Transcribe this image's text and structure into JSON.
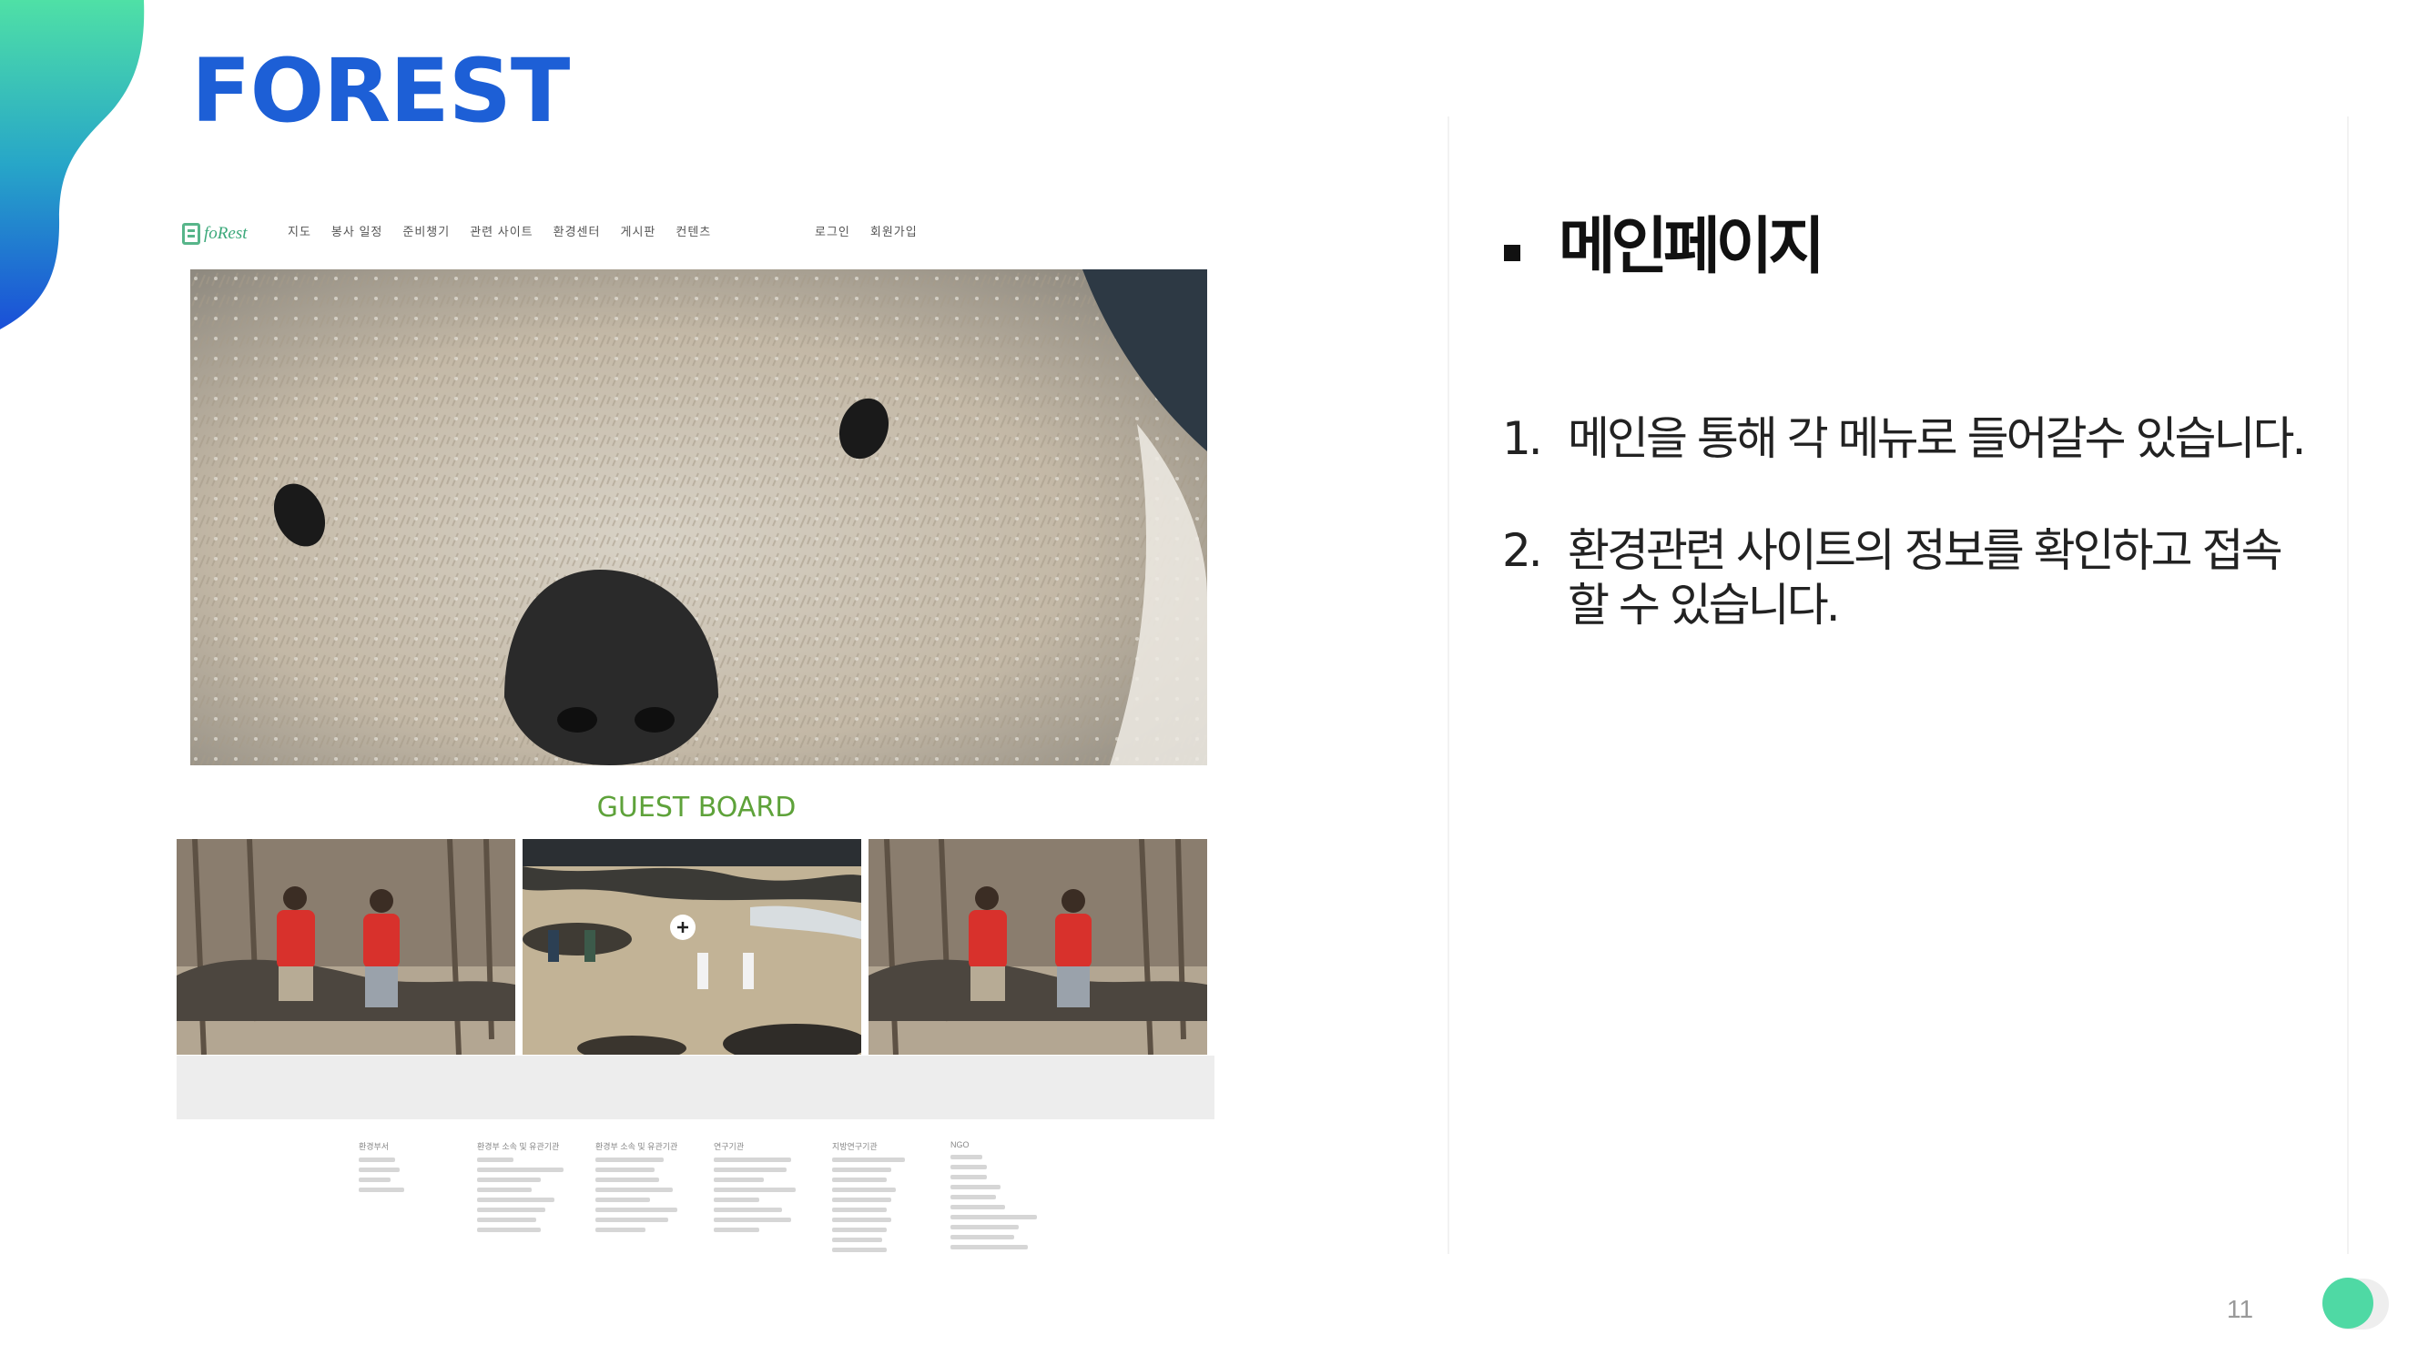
{
  "slide": {
    "title": "FOREST",
    "section_heading": "메인페이지",
    "items": [
      {
        "num": "1.",
        "text": "메인을 통해 각 메뉴로 들어갈수 있습니다."
      },
      {
        "num": "2.",
        "text": "환경관련 사이트의 정보를 확인하고 접속 할 수 있습니다."
      }
    ],
    "page_number": "11"
  },
  "screenshot": {
    "logo_text": "foRest",
    "nav_items": [
      "지도",
      "봉사 일정",
      "준비챙기",
      "관련 사이트",
      "환경센터",
      "게시판",
      "컨텐츠"
    ],
    "nav_right": [
      "로그인",
      "회원가입"
    ],
    "guest_board_title": "GUEST BOARD",
    "footer_columns": [
      "환경부서",
      "환경부 소속 및 유관기관",
      "환경부 소속 및 유관기관",
      "연구기관",
      "지방연구기관",
      "NGO"
    ]
  },
  "colors": {
    "title_blue": "#1d5fd6",
    "accent_green": "#4fd9a4",
    "guest_board_green": "#5ea23a"
  }
}
